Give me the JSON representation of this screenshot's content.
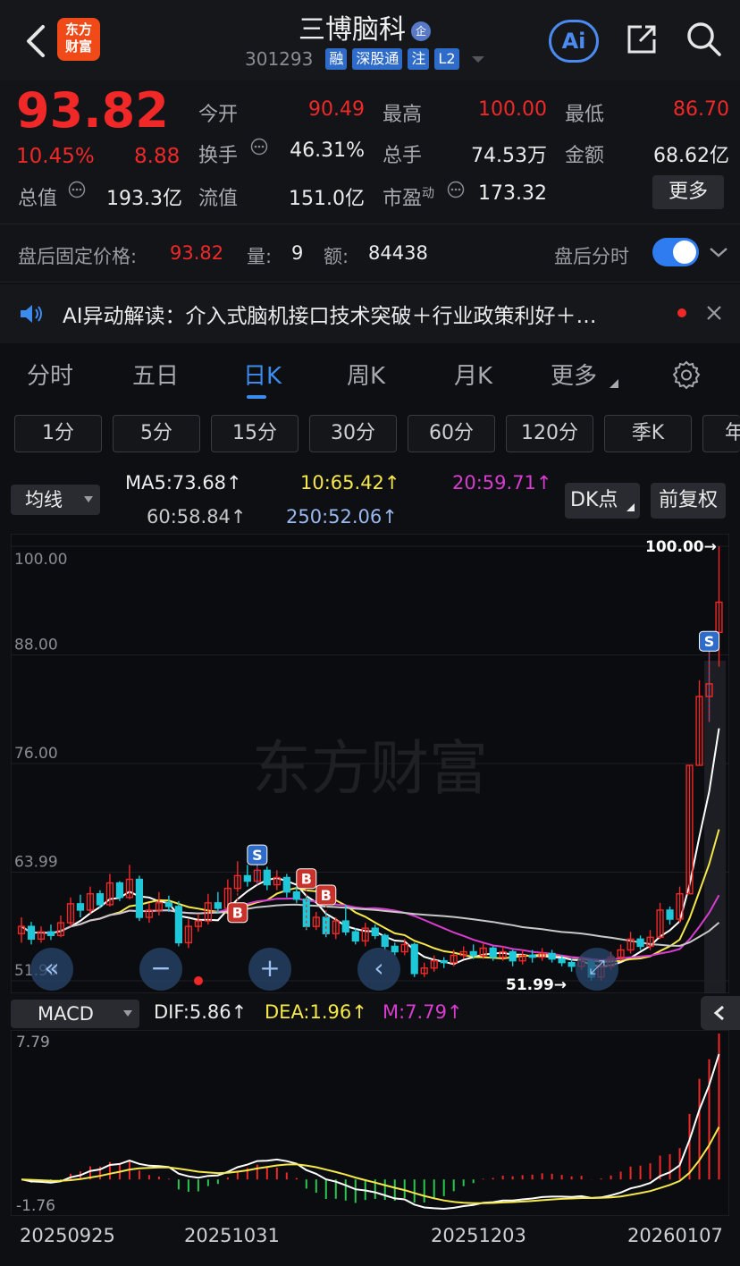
{
  "header": {
    "logo_text": "东方\n财富",
    "stock_name": "三博脑科",
    "badge": "企",
    "code": "301293",
    "tags": [
      "融",
      "深股通",
      "注",
      "L2"
    ],
    "ai_label": "Ai"
  },
  "quote": {
    "price": "93.82",
    "change_pct": "10.45%",
    "change": "8.88",
    "open_label": "今开",
    "open": "90.49",
    "high_label": "最高",
    "high": "100.00",
    "low_label": "最低",
    "low": "86.70",
    "turnover_label": "换手",
    "turnover": "46.31%",
    "volume_label": "总手",
    "volume": "74.53万",
    "amount_label": "金额",
    "amount": "68.62亿",
    "mcap_label": "总值",
    "mcap": "193.3亿",
    "float_label": "流值",
    "float": "151.0亿",
    "pe_label": "市盈",
    "pe_sup": "动",
    "pe": "173.32",
    "more_label": "更多"
  },
  "after_hours": {
    "price_label": "盘后固定价格:",
    "price": "93.82",
    "qty_label": "量:",
    "qty": "9",
    "amt_label": "额:",
    "amt": "84438",
    "timeshare_label": "盘后分时",
    "toggle_on": true
  },
  "ai_read": {
    "text": "AI异动解读：介入式脑机接口技术突破＋行业政策利好＋…"
  },
  "tabs": [
    {
      "label": "分时"
    },
    {
      "label": "五日"
    },
    {
      "label": "日K",
      "active": true
    },
    {
      "label": "周K"
    },
    {
      "label": "月K"
    },
    {
      "label": "更多"
    }
  ],
  "periods": [
    "1分",
    "5分",
    "15分",
    "30分",
    "60分",
    "120分",
    "季K",
    "年"
  ],
  "ma": {
    "selector": "均线",
    "ma5": "MA5:73.68↑",
    "ma10": "10:65.42↑",
    "ma20": "20:59.71↑",
    "ma60": "60:58.84↑",
    "ma250": "250:52.06↑",
    "dk_label": "DK点",
    "fq_label": "前复权"
  },
  "kline": {
    "y_labels": [
      "100.00",
      "88.00",
      "76.00",
      "63.99",
      "51.99"
    ],
    "high_mark": "100.00→",
    "low_mark": "51.99→",
    "watermark": "东方财富",
    "signals": [
      "B",
      "S",
      "B",
      "B",
      "S"
    ]
  },
  "macd": {
    "selector": "MACD",
    "dif": "DIF:5.86↑",
    "dea": "DEA:1.96↑",
    "m": "M:7.79↑",
    "y_top": "7.79",
    "y_bottom": "-1.76"
  },
  "dates": [
    "20250925",
    "20251031",
    "20251203",
    "20260107"
  ],
  "colors": {
    "up": "#f02828",
    "down": "#1ec8d8",
    "ma5": "#ffffff",
    "ma10": "#f5e84a",
    "ma20": "#d83cd0",
    "ma60": "#c8c8c8",
    "accent": "#2f7cf0"
  },
  "chart_data": {
    "type": "candlestick",
    "ylim": [
      51.99,
      100.0
    ],
    "candles": [
      [
        57.2,
        58.0,
        59.0,
        56.2
      ],
      [
        58.0,
        56.6,
        58.5,
        56.0
      ],
      [
        56.6,
        57.4,
        58.0,
        56.2
      ],
      [
        57.4,
        57.0,
        58.2,
        56.5
      ],
      [
        57.0,
        58.4,
        59.2,
        56.8
      ],
      [
        58.4,
        60.5,
        61.2,
        58.0
      ],
      [
        60.5,
        59.8,
        61.5,
        59.0
      ],
      [
        59.8,
        61.6,
        62.4,
        59.4
      ],
      [
        61.6,
        60.4,
        62.0,
        60.0
      ],
      [
        60.4,
        62.8,
        63.8,
        60.2
      ],
      [
        62.8,
        61.2,
        63.0,
        60.8
      ],
      [
        61.2,
        63.2,
        64.8,
        61.0
      ],
      [
        63.2,
        59.0,
        63.6,
        58.6
      ],
      [
        59.0,
        59.8,
        60.6,
        58.4
      ],
      [
        59.8,
        60.6,
        61.8,
        59.2
      ],
      [
        60.6,
        60.2,
        61.4,
        59.6
      ],
      [
        60.2,
        56.2,
        60.8,
        55.8
      ],
      [
        56.2,
        58.0,
        58.8,
        55.6
      ],
      [
        58.0,
        58.6,
        59.4,
        57.4
      ],
      [
        58.6,
        60.6,
        61.6,
        58.2
      ],
      [
        60.6,
        60.0,
        61.8,
        59.4
      ],
      [
        60.0,
        62.2,
        63.2,
        59.6
      ],
      [
        62.2,
        63.6,
        65.2,
        61.8
      ],
      [
        63.6,
        63.0,
        64.8,
        62.4
      ],
      [
        63.0,
        64.2,
        66.6,
        62.6
      ],
      [
        64.2,
        62.6,
        64.6,
        62.0
      ],
      [
        62.6,
        63.4,
        64.2,
        62.0
      ],
      [
        63.4,
        61.8,
        63.8,
        61.2
      ],
      [
        61.8,
        61.0,
        62.4,
        60.6
      ],
      [
        61.0,
        58.0,
        61.4,
        57.6
      ],
      [
        58.0,
        59.0,
        59.6,
        57.6
      ],
      [
        59.0,
        57.2,
        59.6,
        56.8
      ],
      [
        57.2,
        58.6,
        59.0,
        56.6
      ],
      [
        58.6,
        57.4,
        60.4,
        57.0
      ],
      [
        57.4,
        56.4,
        57.8,
        56.0
      ],
      [
        56.4,
        57.8,
        58.4,
        55.8
      ],
      [
        57.8,
        57.0,
        58.2,
        56.6
      ],
      [
        57.0,
        55.8,
        57.2,
        55.4
      ],
      [
        55.8,
        55.2,
        56.2,
        54.8
      ],
      [
        55.2,
        56.0,
        56.6,
        54.8
      ],
      [
        56.0,
        52.8,
        56.2,
        52.4
      ],
      [
        52.8,
        53.4,
        54.0,
        52.4
      ],
      [
        53.4,
        54.2,
        54.8,
        53.0
      ],
      [
        54.2,
        54.0,
        54.6,
        53.4
      ],
      [
        54.0,
        54.8,
        55.4,
        53.6
      ],
      [
        54.8,
        55.2,
        55.8,
        54.4
      ],
      [
        55.2,
        54.8,
        56.0,
        54.4
      ],
      [
        54.8,
        55.6,
        56.2,
        54.4
      ],
      [
        55.6,
        54.6,
        55.8,
        54.2
      ],
      [
        54.6,
        55.2,
        55.8,
        54.2
      ],
      [
        55.2,
        54.2,
        55.4,
        53.6
      ],
      [
        54.2,
        54.8,
        55.4,
        53.8
      ],
      [
        54.8,
        54.6,
        55.4,
        54.0
      ],
      [
        54.6,
        55.0,
        55.6,
        54.2
      ],
      [
        55.0,
        54.4,
        55.4,
        54.0
      ],
      [
        54.4,
        54.0,
        54.8,
        53.6
      ],
      [
        54.0,
        53.6,
        54.4,
        53.0
      ],
      [
        53.6,
        54.2,
        54.8,
        53.2
      ],
      [
        54.2,
        52.4,
        54.4,
        52.0
      ],
      [
        52.4,
        53.6,
        54.2,
        52.0
      ],
      [
        53.6,
        54.6,
        55.2,
        53.2
      ],
      [
        54.6,
        55.4,
        56.0,
        54.2
      ],
      [
        55.4,
        56.6,
        57.4,
        55.0
      ],
      [
        56.6,
        55.8,
        57.0,
        55.4
      ],
      [
        55.8,
        56.8,
        57.6,
        55.4
      ],
      [
        56.8,
        59.8,
        60.6,
        56.6
      ],
      [
        59.8,
        58.8,
        60.2,
        58.2
      ],
      [
        58.8,
        61.6,
        62.4,
        58.4
      ],
      [
        61.6,
        75.8,
        75.8,
        61.6
      ],
      [
        75.8,
        83.4,
        85.2,
        75.8
      ],
      [
        83.4,
        84.8,
        90.2,
        80.6
      ],
      [
        90.49,
        93.82,
        100.0,
        86.7
      ]
    ]
  }
}
